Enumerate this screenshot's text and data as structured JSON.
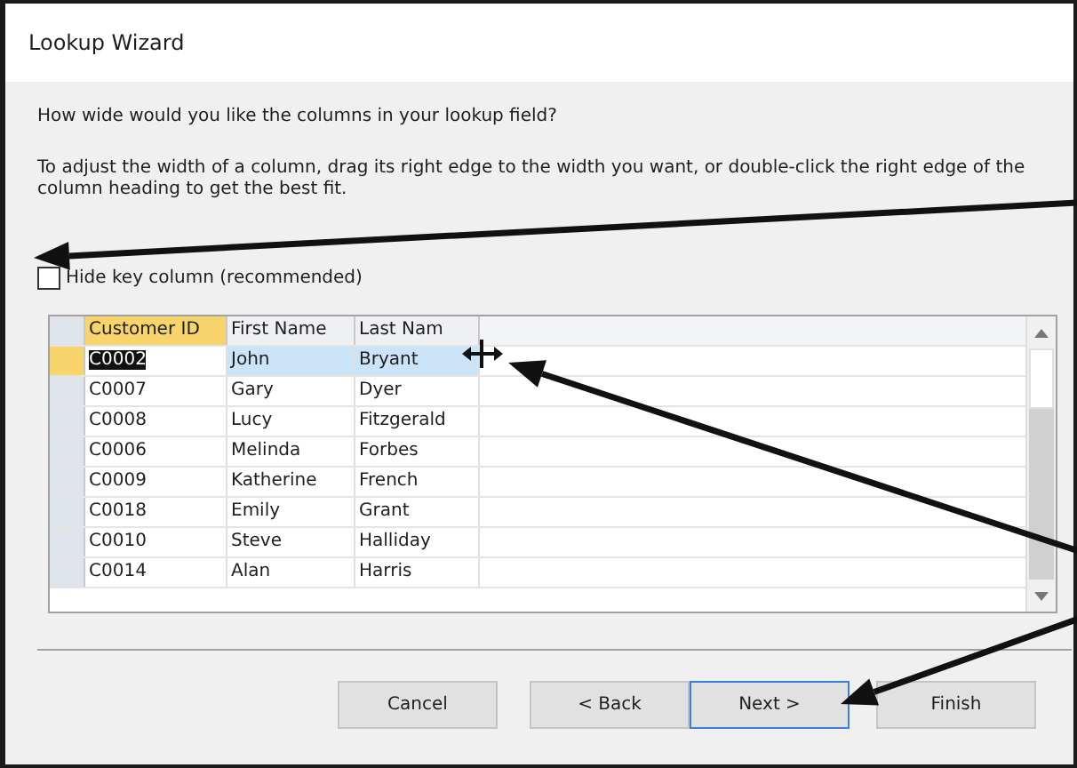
{
  "window": {
    "title": "Lookup Wizard"
  },
  "question": "How wide would you like the columns in your lookup field?",
  "instructions": "To adjust the width of a column, drag its right edge to the width you want, or double-click the right edge of the column heading to get the best fit.",
  "hide_key_column": {
    "label": "Hide key column (recommended)",
    "checked": false
  },
  "table": {
    "columns": [
      {
        "label": "Customer ID",
        "selected": true
      },
      {
        "label": "First Name",
        "selected": false
      },
      {
        "label": "Last Nam",
        "selected": false
      }
    ],
    "rows": [
      {
        "cells": [
          "C0002",
          "John",
          "Bryant"
        ],
        "selected": true
      },
      {
        "cells": [
          "C0007",
          "Gary",
          "Dyer"
        ],
        "selected": false
      },
      {
        "cells": [
          "C0008",
          "Lucy",
          "Fitzgerald"
        ],
        "selected": false
      },
      {
        "cells": [
          "C0006",
          "Melinda",
          "Forbes"
        ],
        "selected": false
      },
      {
        "cells": [
          "C0009",
          "Katherine",
          "French"
        ],
        "selected": false
      },
      {
        "cells": [
          "C0018",
          "Emily",
          "Grant"
        ],
        "selected": false
      },
      {
        "cells": [
          "C0010",
          "Steve",
          "Halliday"
        ],
        "selected": false
      },
      {
        "cells": [
          "C0014",
          "Alan",
          "Harris"
        ],
        "selected": false
      }
    ]
  },
  "buttons": [
    {
      "label": "Cancel",
      "default": false
    },
    {
      "label": "< Back",
      "default": false
    },
    {
      "label": "Next >",
      "default": true
    },
    {
      "label": "Finish",
      "default": false
    }
  ]
}
